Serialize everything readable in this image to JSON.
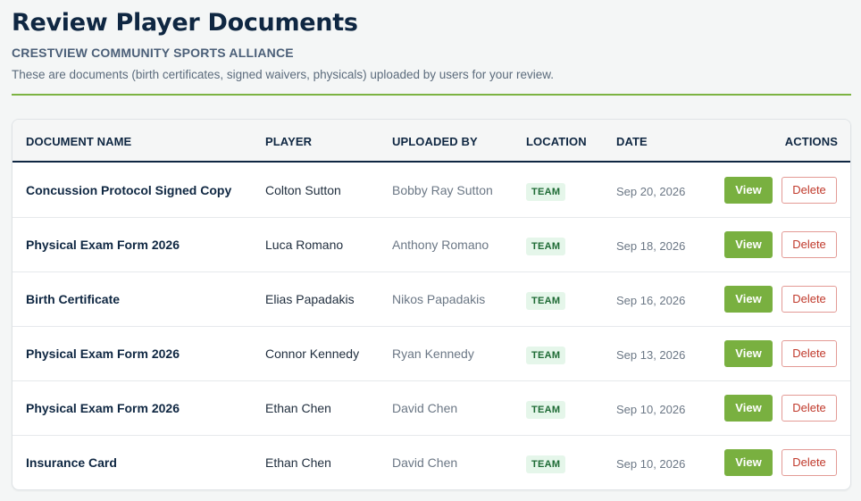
{
  "page": {
    "title": "Review Player Documents",
    "organization": "CRESTVIEW COMMUNITY SPORTS ALLIANCE",
    "description": "These are documents (birth certificates, signed waivers, physicals) uploaded by users for your review."
  },
  "colors": {
    "accent": "#7cb342",
    "navy": "#0f2742",
    "view_button": "#79b040",
    "delete_text": "#c0392b",
    "badge_bg": "#e5f6ea",
    "badge_text": "#1e6b35"
  },
  "table": {
    "headers": {
      "document_name": "DOCUMENT NAME",
      "player": "PLAYER",
      "uploaded_by": "UPLOADED BY",
      "location": "LOCATION",
      "date": "DATE",
      "actions": "ACTIONS"
    },
    "rows": [
      {
        "document": "Concussion Protocol Signed Copy",
        "player": "Colton Sutton",
        "uploaded_by": "Bobby Ray Sutton",
        "location": "TEAM",
        "date": "Sep 20, 2026",
        "view_label": "View",
        "delete_label": "Delete"
      },
      {
        "document": "Physical Exam Form 2026",
        "player": "Luca Romano",
        "uploaded_by": "Anthony Romano",
        "location": "TEAM",
        "date": "Sep 18, 2026",
        "view_label": "View",
        "delete_label": "Delete"
      },
      {
        "document": "Birth Certificate",
        "player": "Elias Papadakis",
        "uploaded_by": "Nikos Papadakis",
        "location": "TEAM",
        "date": "Sep 16, 2026",
        "view_label": "View",
        "delete_label": "Delete"
      },
      {
        "document": "Physical Exam Form 2026",
        "player": "Connor Kennedy",
        "uploaded_by": "Ryan Kennedy",
        "location": "TEAM",
        "date": "Sep 13, 2026",
        "view_label": "View",
        "delete_label": "Delete"
      },
      {
        "document": "Physical Exam Form 2026",
        "player": "Ethan Chen",
        "uploaded_by": "David Chen",
        "location": "TEAM",
        "date": "Sep 10, 2026",
        "view_label": "View",
        "delete_label": "Delete"
      },
      {
        "document": "Insurance Card",
        "player": "Ethan Chen",
        "uploaded_by": "David Chen",
        "location": "TEAM",
        "date": "Sep 10, 2026",
        "view_label": "View",
        "delete_label": "Delete"
      }
    ]
  }
}
